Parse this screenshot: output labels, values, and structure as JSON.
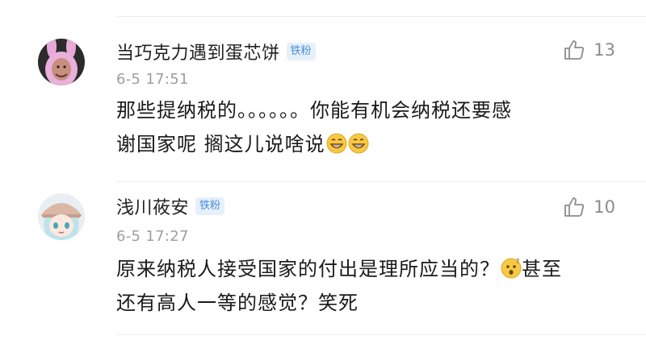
{
  "comments": [
    {
      "username": "当巧克力遇到蛋芯饼",
      "badge": "铁粉",
      "time": "6-5 17:51",
      "likes": "13",
      "text_line1": "那些提纳税的。。。。。。你能有机会纳税还要感",
      "text_line2": "谢国家呢 搁这儿说啥说",
      "avatar_icon": "bunny-costume-avatar",
      "emojis": [
        "grinning-face-icon",
        "grinning-face-icon"
      ]
    },
    {
      "username": "浅川莜安",
      "badge": "铁粉",
      "time": "6-5 17:27",
      "likes": "10",
      "text_line1": "原来纳税人接受国家的付出是理所应当的？",
      "text_line1_after": "甚至",
      "text_line2": "还有高人一等的感觉？笑死",
      "avatar_icon": "anime-girl-avatar",
      "emojis": [
        "confused-face-icon"
      ]
    }
  ],
  "colors": {
    "badge_bg": "#e6f0fb",
    "badge_text": "#4a8fd9",
    "meta_gray": "#9e9e9e",
    "divider": "#eeeeee"
  }
}
